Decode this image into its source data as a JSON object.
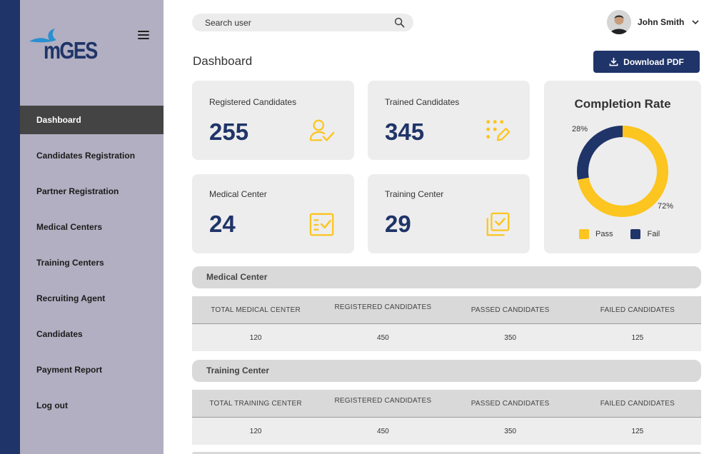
{
  "brand": {
    "logo_text": "mGES"
  },
  "sidebar": {
    "items": [
      {
        "label": "Dashboard",
        "active": true
      },
      {
        "label": "Candidates Registration"
      },
      {
        "label": "Partner Registration"
      },
      {
        "label": "Medical Centers"
      },
      {
        "label": "Training Centers"
      },
      {
        "label": "Recruiting Agent"
      },
      {
        "label": "Candidates"
      },
      {
        "label": "Payment Report"
      },
      {
        "label": "Log out"
      }
    ]
  },
  "header": {
    "search_placeholder": "Search user",
    "user_name": "John Smith",
    "page_title": "Dashboard",
    "download_label": "Download PDF"
  },
  "cards": [
    {
      "label": "Registered Candidates",
      "value": "255",
      "icon": "user-check-icon"
    },
    {
      "label": "Trained Candidates",
      "value": "345",
      "icon": "dots-pencil-icon"
    },
    {
      "label": "Medical Center",
      "value": "24",
      "icon": "checklist-icon"
    },
    {
      "label": "Training Center",
      "value": "29",
      "icon": "stacked-check-icon"
    }
  ],
  "completion": {
    "title": "Completion Rate",
    "fail_pct": "28%",
    "pass_pct": "72%",
    "legend_pass": "Pass",
    "legend_fail": "Fail",
    "pass_fraction": 0.72,
    "fail_fraction": 0.28
  },
  "colors": {
    "accent": "#1f3468",
    "highlight": "#fcc51f",
    "sidebar": "#b1afc1"
  },
  "medical_section": {
    "title": "Medical Center",
    "headers": [
      "TOTAL MEDICAL CENTER",
      "REGISTERED CANDIDATES",
      "PASSED CANDIDATES",
      "FAILED CANDIDATES"
    ],
    "row": [
      "120",
      "450",
      "350",
      "125"
    ]
  },
  "training_section": {
    "title": "Training Center",
    "headers": [
      "TOTAL TRAINING CENTER",
      "REGISTERED CANDIDATES",
      "PASSED CANDIDATES",
      "FAILED CANDIDATES"
    ],
    "row": [
      "120",
      "450",
      "350",
      "125"
    ]
  }
}
